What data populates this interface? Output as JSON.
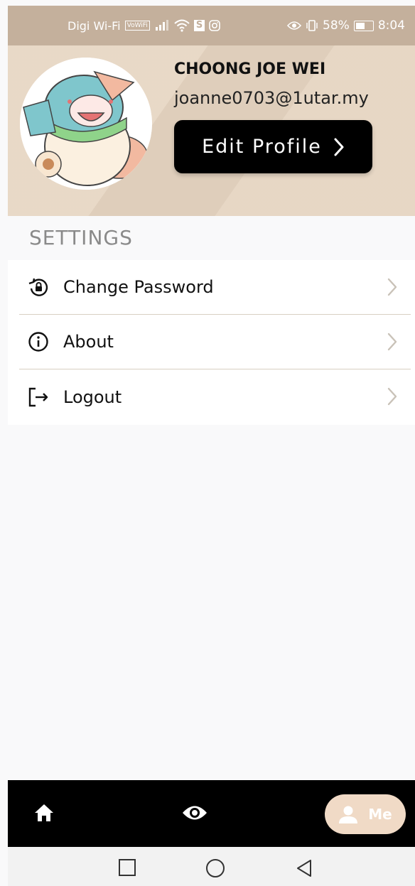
{
  "status_bar": {
    "carrier": "Digi Wi-Fi",
    "volte": "VoWiFi",
    "app_badge": "S",
    "battery": "58%",
    "time": "8:04"
  },
  "profile": {
    "name": "CHOONG JOE WEI",
    "email": "joanne0703@1utar.my",
    "edit_button": "Edit Profile"
  },
  "settings": {
    "title": "SETTINGS",
    "items": [
      {
        "label": "Change Password",
        "icon": "lock-reset-icon"
      },
      {
        "label": "About",
        "icon": "info-icon"
      },
      {
        "label": "Logout",
        "icon": "logout-icon"
      }
    ]
  },
  "bottom_nav": {
    "items": [
      {
        "icon": "home-icon"
      },
      {
        "icon": "eye-icon"
      },
      {
        "icon": "person-icon",
        "label": "Me",
        "active": true
      }
    ]
  },
  "colors": {
    "accent": "#e6d5c1",
    "status_bar": "#c4b09c",
    "active_tab": "#f0dac6"
  }
}
